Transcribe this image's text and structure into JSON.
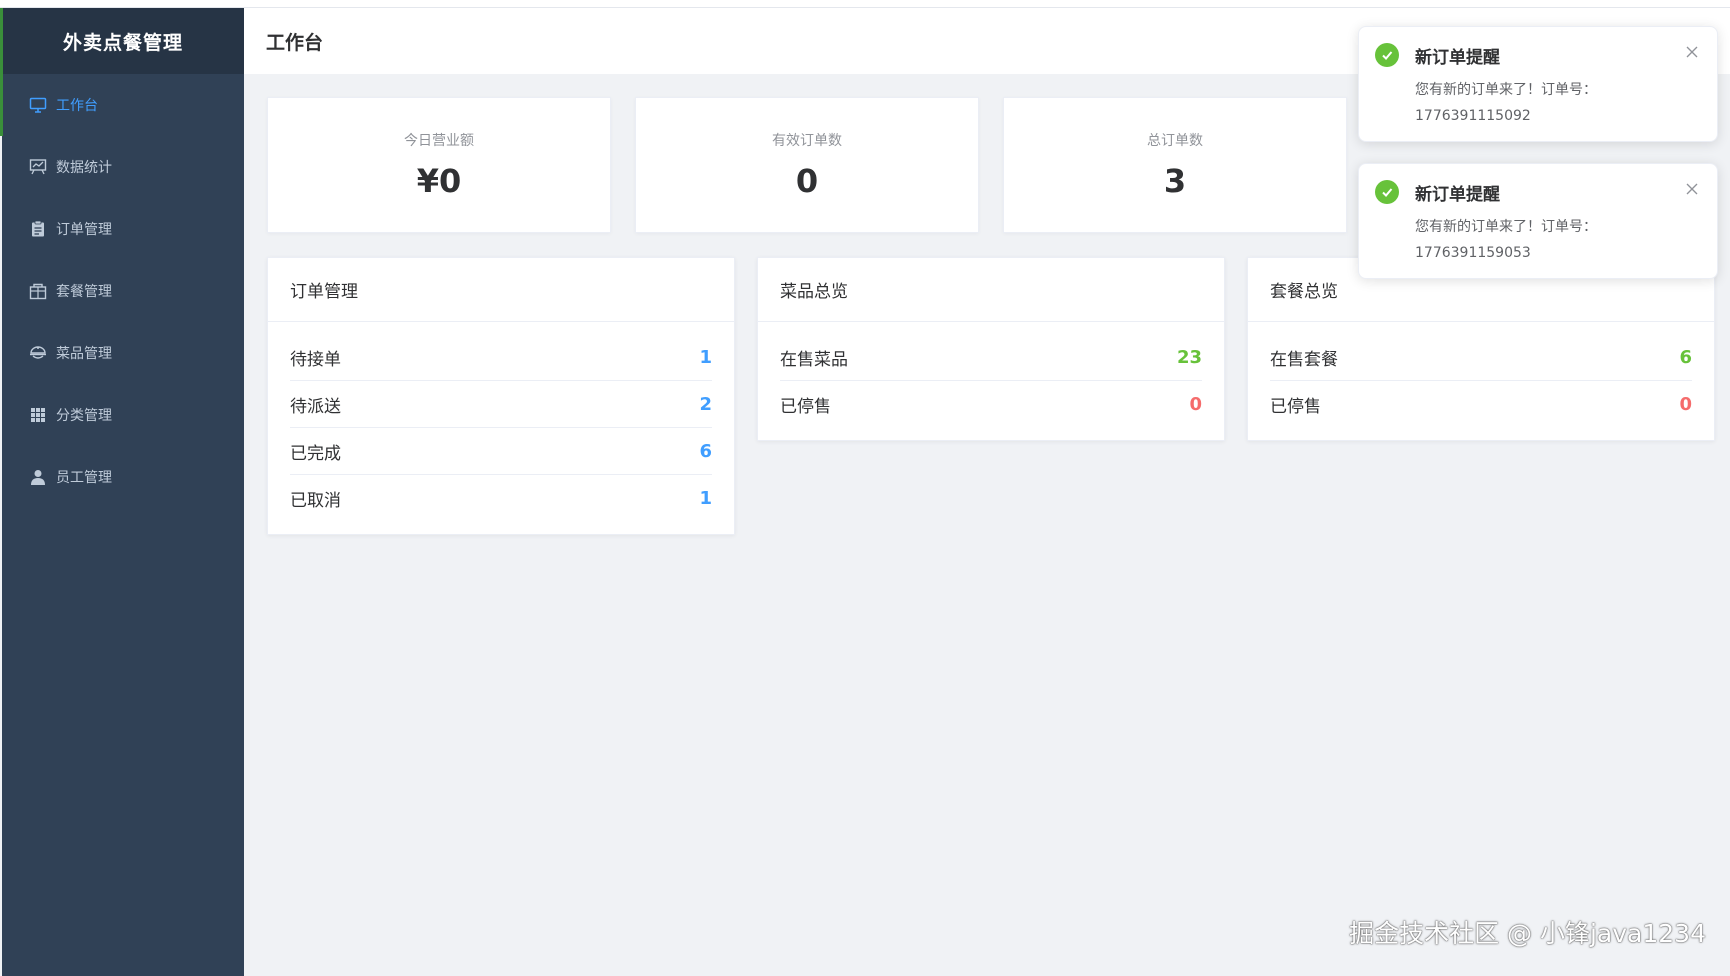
{
  "app": {
    "title": "外卖点餐管理"
  },
  "sidebar": {
    "items": [
      {
        "label": "工作台",
        "icon": "monitor-icon",
        "active": true
      },
      {
        "label": "数据统计",
        "icon": "chart-board-icon",
        "active": false
      },
      {
        "label": "订单管理",
        "icon": "clipboard-icon",
        "active": false
      },
      {
        "label": "套餐管理",
        "icon": "package-icon",
        "active": false
      },
      {
        "label": "菜品管理",
        "icon": "dish-icon",
        "active": false
      },
      {
        "label": "分类管理",
        "icon": "grid-icon",
        "active": false
      },
      {
        "label": "员工管理",
        "icon": "user-icon",
        "active": false
      }
    ]
  },
  "header": {
    "title": "工作台"
  },
  "stats": [
    {
      "label": "今日营业额",
      "value": "¥0"
    },
    {
      "label": "有效订单数",
      "value": "0"
    },
    {
      "label": "总订单数",
      "value": "3"
    }
  ],
  "orders_panel": {
    "title": "订单管理",
    "rows": [
      {
        "label": "待接单",
        "value": "1"
      },
      {
        "label": "待派送",
        "value": "2"
      },
      {
        "label": "已完成",
        "value": "6"
      },
      {
        "label": "已取消",
        "value": "1"
      }
    ]
  },
  "dishes_panel": {
    "title": "菜品总览",
    "rows": [
      {
        "label": "在售菜品",
        "value": "23"
      },
      {
        "label": "已停售",
        "value": "0"
      }
    ]
  },
  "setmeal_panel": {
    "title": "套餐总览",
    "rows": [
      {
        "label": "在售套餐",
        "value": "6"
      },
      {
        "label": "已停售",
        "value": "0"
      }
    ]
  },
  "notifications": [
    {
      "title": "新订单提醒",
      "message": "您有新的订单来了！订单号：",
      "order_no": "1776391115092"
    },
    {
      "title": "新订单提醒",
      "message": "您有新的订单来了！订单号：",
      "order_no": "1776391159053"
    }
  ],
  "watermark": "掘金技术社区 @ 小锋java1234",
  "colors": {
    "sidebar_bg": "#304156",
    "accent": "#409eff",
    "success": "#67c23a",
    "danger": "#f56c6c"
  }
}
